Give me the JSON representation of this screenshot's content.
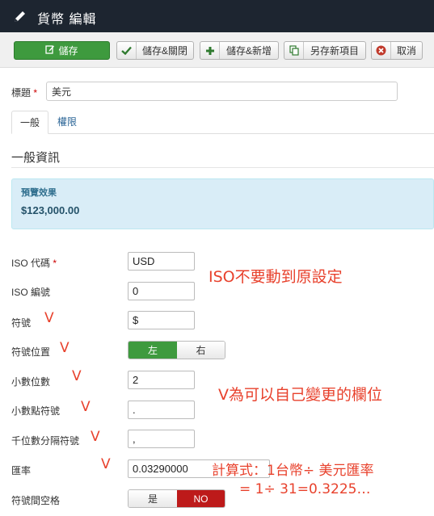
{
  "header": {
    "title": "貨幣 編輯",
    "icon": "pencil-icon"
  },
  "toolbar": {
    "save": {
      "label": "儲存",
      "icon": "edit-icon"
    },
    "save_close": {
      "label": "儲存&關閉",
      "icon": "check-icon"
    },
    "save_new": {
      "label": "儲存&新增",
      "icon": "plus-icon"
    },
    "save_copy": {
      "label": "另存新項目",
      "icon": "copy-icon"
    },
    "cancel": {
      "label": "取消",
      "icon": "cancel-circle-icon"
    }
  },
  "form": {
    "title_label": "標題",
    "required_mark": "*",
    "title_value": "美元"
  },
  "tabs": [
    {
      "label": "一般"
    },
    {
      "label": "權限"
    }
  ],
  "section": {
    "title": "一般資訊"
  },
  "preview": {
    "heading": "預覽效果",
    "value": "$123,000.00"
  },
  "fields": {
    "iso_code": {
      "label": "ISO 代碼",
      "value": "USD"
    },
    "iso_number": {
      "label": "ISO 編號",
      "value": "0"
    },
    "symbol": {
      "label": "符號",
      "value": "$"
    },
    "symbol_position": {
      "label": "符號位置",
      "left": "左",
      "right": "右",
      "selected": "左"
    },
    "decimals": {
      "label": "小數位數",
      "value": "2"
    },
    "decimal_symbol": {
      "label": "小數點符號",
      "value": "."
    },
    "thousands_separator": {
      "label": "千位數分隔符號",
      "value": ","
    },
    "exchange_rate": {
      "label": "匯率",
      "value": "0.03290000"
    },
    "symbol_space": {
      "label": "符號間空格",
      "yes": "是",
      "no": "NO",
      "selected": "NO"
    }
  },
  "annotations": {
    "iso_note": "ISO不要動到原設定",
    "v_note": "V為可以自己變更的欄位",
    "formula_line1": "計算式：1台幣÷ 美元匯率",
    "formula_line2": "= 1÷ 31=0.3225…",
    "check_mark": "V"
  },
  "colors": {
    "header_bg": "#1d2530",
    "save_green": "#3e9a3e",
    "no_red": "#bd1a1a",
    "annotation_red": "#e8412c",
    "preview_bg": "#d9edf7"
  }
}
